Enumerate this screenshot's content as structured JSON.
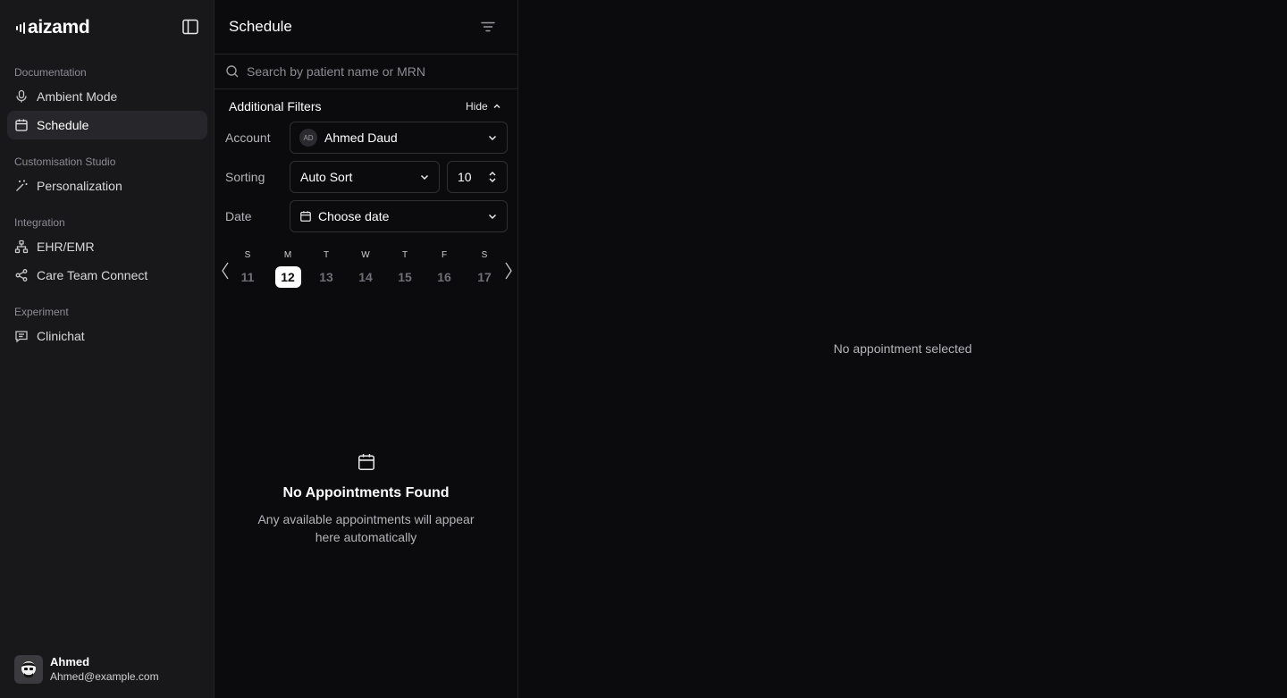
{
  "sidebar": {
    "brand": "aizamd",
    "groups": [
      {
        "label": "Documentation",
        "items": [
          {
            "label": "Ambient Mode",
            "icon": "mic-icon"
          },
          {
            "label": "Schedule",
            "icon": "calendar-icon",
            "active": true
          }
        ]
      },
      {
        "label": "Customisation Studio",
        "items": [
          {
            "label": "Personalization",
            "icon": "magic-wand-icon"
          }
        ]
      },
      {
        "label": "Integration",
        "items": [
          {
            "label": "EHR/EMR",
            "icon": "network-icon"
          },
          {
            "label": "Care Team Connect",
            "icon": "share-icon"
          }
        ]
      },
      {
        "label": "Experiment",
        "items": [
          {
            "label": "Clinichat",
            "icon": "chat-icon"
          }
        ]
      }
    ],
    "user": {
      "name": "Ahmed",
      "email": "Ahmed@example.com"
    }
  },
  "schedule": {
    "title": "Schedule",
    "search_placeholder": "Search by patient name or MRN",
    "filters": {
      "title": "Additional Filters",
      "hide_label": "Hide",
      "account_label": "Account",
      "account_initials": "AD",
      "account_value": "Ahmed Daud",
      "sorting_label": "Sorting",
      "sorting_value": "Auto Sort",
      "count_value": "10",
      "date_label": "Date",
      "date_value": "Choose date"
    },
    "week": [
      {
        "letter": "S",
        "num": "11"
      },
      {
        "letter": "M",
        "num": "12",
        "selected": true
      },
      {
        "letter": "T",
        "num": "13"
      },
      {
        "letter": "W",
        "num": "14"
      },
      {
        "letter": "T",
        "num": "15"
      },
      {
        "letter": "F",
        "num": "16"
      },
      {
        "letter": "S",
        "num": "17"
      }
    ],
    "empty": {
      "title": "No Appointments Found",
      "subtitle": "Any available appointments will appear here automatically"
    }
  },
  "detail": {
    "empty_text": "No appointment selected"
  },
  "colors": {
    "background": "#0b0b0d",
    "sidebar": "#18181b",
    "active_item": "#27272b",
    "border": "#232327",
    "selected_day": "#ffffff"
  }
}
